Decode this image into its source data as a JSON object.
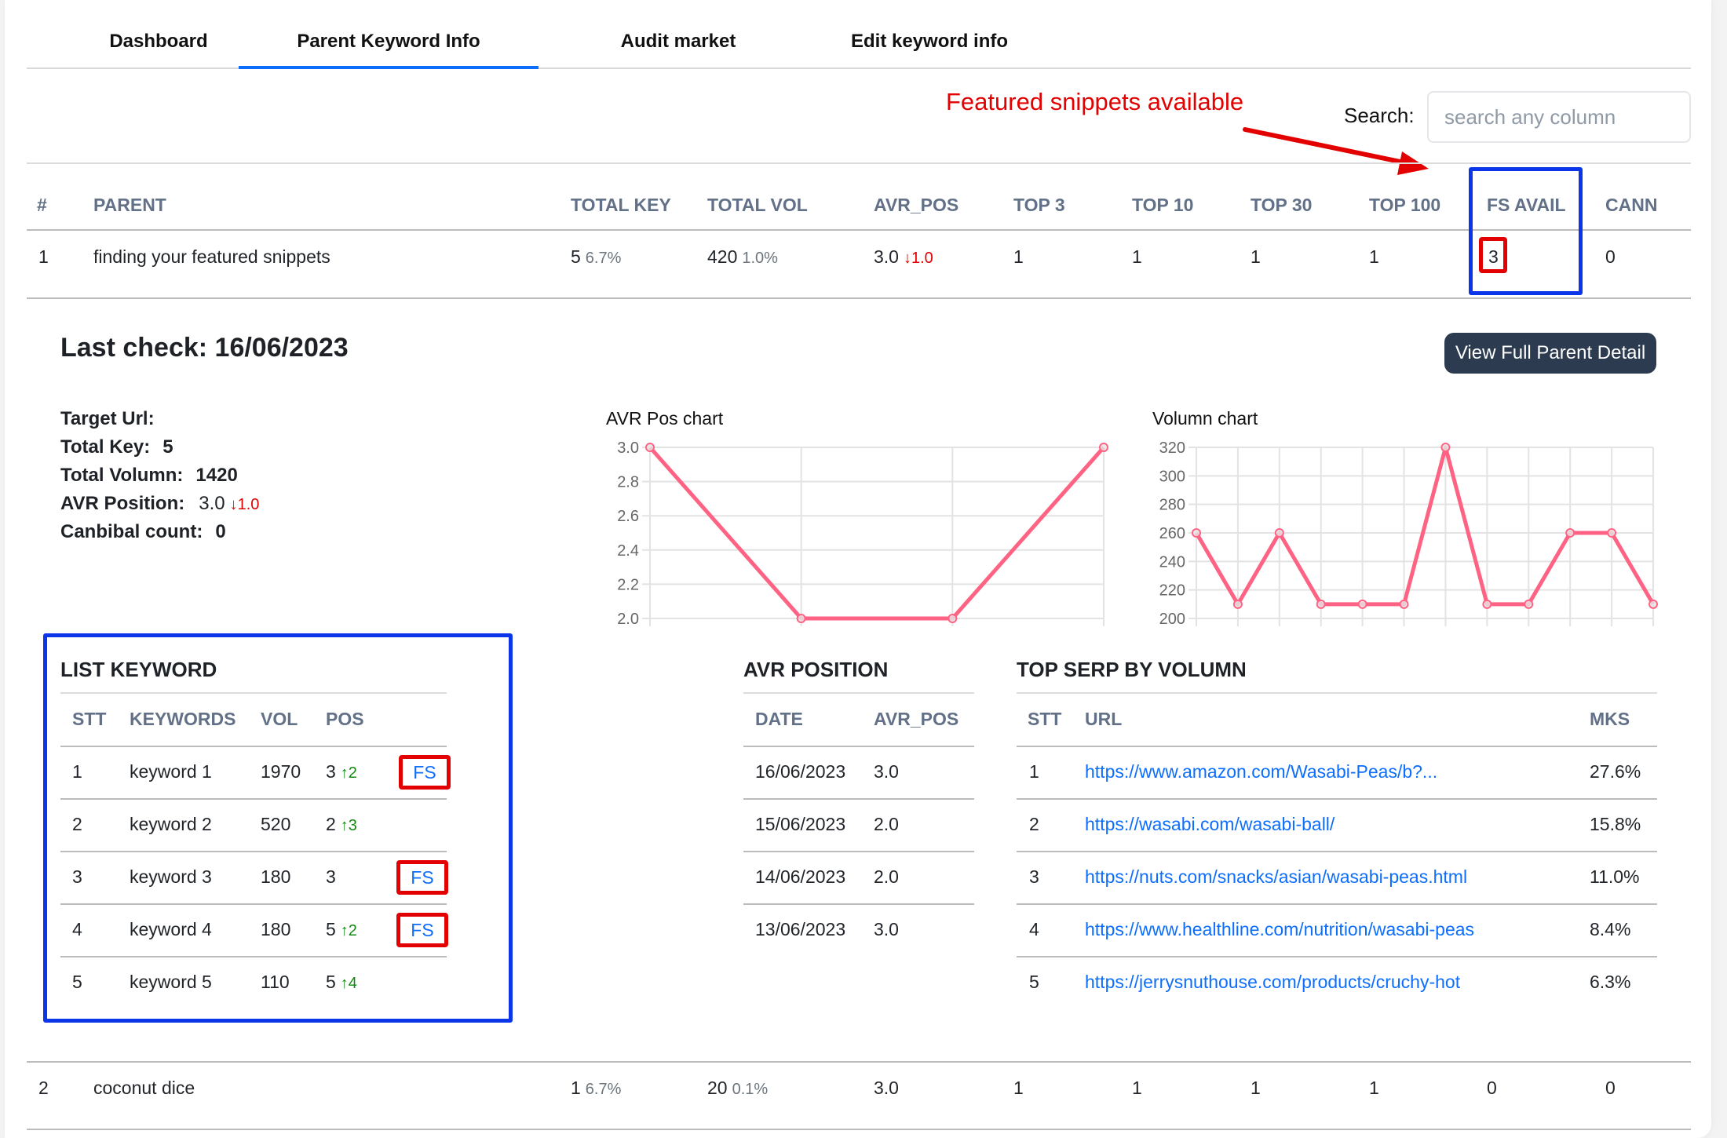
{
  "tabs": [
    {
      "label": "Dashboard",
      "active": false
    },
    {
      "label": "Parent Keyword Info",
      "active": true
    },
    {
      "label": "Audit market",
      "active": false
    },
    {
      "label": "Edit keyword info",
      "active": false
    }
  ],
  "annotation": {
    "text": "Featured snippets available",
    "color": "#e30000"
  },
  "search": {
    "label": "Search:",
    "placeholder": "search any column",
    "value": ""
  },
  "main_table": {
    "headers": [
      "#",
      "PARENT",
      "TOTAL KEY",
      "TOTAL VOL",
      "AVR_POS",
      "TOP 3",
      "TOP 10",
      "TOP 30",
      "TOP 100",
      "FS AVAIL",
      "CANN"
    ],
    "rows": [
      {
        "num": "1",
        "parent": "finding your featured snippets",
        "total_key": "5",
        "total_key_pct": "6.7%",
        "total_vol": "420",
        "total_vol_pct": "1.0%",
        "avr_pos": "3.0",
        "avr_pos_change": "↓1.0",
        "top3": "1",
        "top10": "1",
        "top30": "1",
        "top100": "1",
        "fs_avail": "3",
        "cann": "0"
      },
      {
        "num": "2",
        "parent": "coconut dice",
        "total_key": "1",
        "total_key_pct": "6.7%",
        "total_vol": "20",
        "total_vol_pct": "0.1%",
        "avr_pos": "3.0",
        "avr_pos_change": "",
        "top3": "1",
        "top10": "1",
        "top30": "1",
        "top100": "1",
        "fs_avail": "0",
        "cann": "0"
      }
    ]
  },
  "detail": {
    "last_check": "Last check: 16/06/2023",
    "view_button": "View Full Parent Detail",
    "info": {
      "target_url_label": "Target Url:",
      "target_url": "",
      "total_key_label": "Total Key:",
      "total_key": "5",
      "total_volumn_label": "Total Volumn:",
      "total_volumn": "1420",
      "avr_position_label": "AVR Position:",
      "avr_position": "3.0",
      "avr_position_change": "↓1.0",
      "canbibal_label": "Canbibal count:",
      "canbibal": "0"
    },
    "list_keyword": {
      "title": "LIST KEYWORD",
      "headers": [
        "STT",
        "KEYWORDS",
        "VOL",
        "POS"
      ],
      "fs_label": "FS",
      "rows": [
        {
          "stt": "1",
          "keyword": "keyword 1",
          "vol": "1970",
          "pos": "3",
          "change": "↑2",
          "fs": true
        },
        {
          "stt": "2",
          "keyword": "keyword 2",
          "vol": "520",
          "pos": "2",
          "change": "↑3",
          "fs": false
        },
        {
          "stt": "3",
          "keyword": "keyword 3",
          "vol": "180",
          "pos": "3",
          "change": "",
          "fs": true
        },
        {
          "stt": "4",
          "keyword": "keyword 4",
          "vol": "180",
          "pos": "5",
          "change": "↑2",
          "fs": true
        },
        {
          "stt": "5",
          "keyword": "keyword 5",
          "vol": "110",
          "pos": "5",
          "change": "↑4",
          "fs": false
        }
      ]
    },
    "avr_position_table": {
      "title": "AVR POSITION",
      "headers": [
        "DATE",
        "AVR_POS"
      ],
      "rows": [
        {
          "date": "16/06/2023",
          "avr_pos": "3.0"
        },
        {
          "date": "15/06/2023",
          "avr_pos": "2.0"
        },
        {
          "date": "14/06/2023",
          "avr_pos": "2.0"
        },
        {
          "date": "13/06/2023",
          "avr_pos": "3.0"
        }
      ]
    },
    "top_serp": {
      "title": "TOP SERP BY VOLUMN",
      "headers": [
        "STT",
        "URL",
        "MKS"
      ],
      "rows": [
        {
          "stt": "1",
          "url": "https://www.amazon.com/Wasabi-Peas/b?...",
          "mks": "27.6%"
        },
        {
          "stt": "2",
          "url": "https://wasabi.com/wasabi-ball/",
          "mks": "15.8%"
        },
        {
          "stt": "3",
          "url": "https://nuts.com/snacks/asian/wasabi-peas.html",
          "mks": "11.0%"
        },
        {
          "stt": "4",
          "url": "https://www.healthline.com/nutrition/wasabi-peas",
          "mks": "8.4%"
        },
        {
          "stt": "5",
          "url": "https://jerrysnuthouse.com/products/cruchy-hot",
          "mks": "6.3%"
        }
      ]
    }
  },
  "chart_data": [
    {
      "type": "line",
      "title": "AVR Pos chart",
      "x": [
        1,
        2,
        3,
        4
      ],
      "values": [
        3.0,
        2.0,
        2.0,
        3.0
      ],
      "ylim": [
        2.0,
        3.0
      ],
      "yticks": [
        "3.0",
        "2.8",
        "2.6",
        "2.4",
        "2.2",
        "2.0"
      ],
      "xlabel": "",
      "ylabel": "",
      "grid": true,
      "color": "#ff6384"
    },
    {
      "type": "line",
      "title": "Volumn chart",
      "x": [
        1,
        2,
        3,
        4,
        5,
        6,
        7,
        8,
        9,
        10,
        11,
        12
      ],
      "values": [
        260,
        210,
        260,
        210,
        210,
        210,
        320,
        210,
        210,
        260,
        260,
        210
      ],
      "ylim": [
        200,
        320
      ],
      "yticks": [
        "320",
        "300",
        "280",
        "260",
        "240",
        "220",
        "200"
      ],
      "xlabel": "",
      "ylabel": "",
      "grid": true,
      "color": "#ff6384"
    }
  ]
}
